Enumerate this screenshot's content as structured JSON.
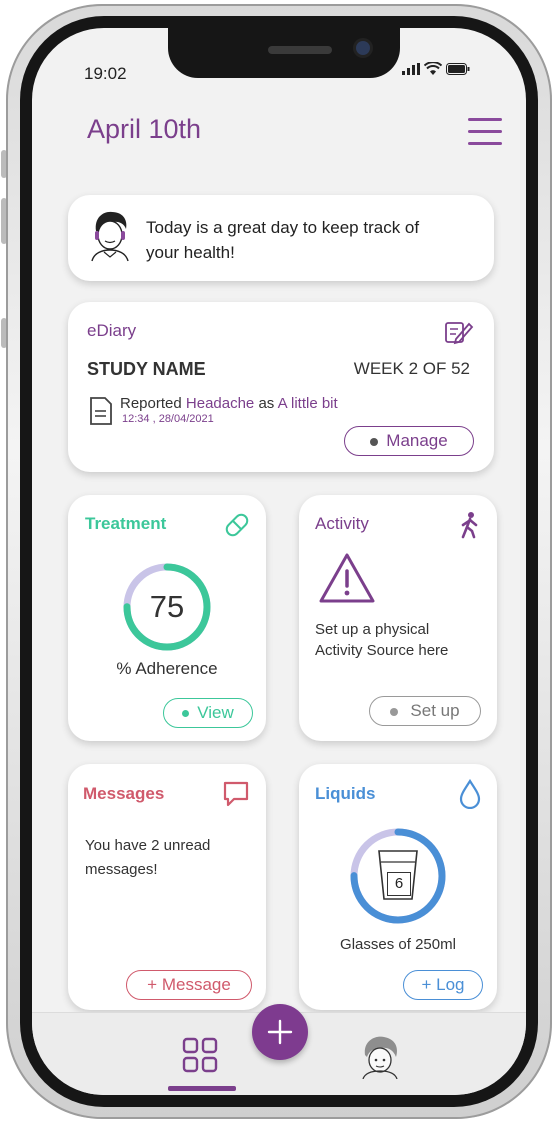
{
  "status": {
    "time": "19:02"
  },
  "header": {
    "title": "April 10th"
  },
  "greeting": {
    "text_line1": "Today is a great day to keep track of",
    "text_line2": "your health!"
  },
  "ediary": {
    "label": "eDiary",
    "study_name": "STUDY NAME",
    "week": "WEEK 2 OF 52",
    "report_prefix": "Reported",
    "report_symptom": "Headache",
    "report_mid": "as",
    "report_level": "A little bit",
    "report_time": "12:34 , 28/04/2021",
    "manage_label": "Manage"
  },
  "treatment": {
    "label": "Treatment",
    "value": "75",
    "value_fraction": 0.75,
    "caption": "% Adherence",
    "view_label": "View"
  },
  "activity": {
    "label": "Activity",
    "text_line1": "Set up a physical",
    "text_line2": "Activity Source here",
    "setup_label": "Set up"
  },
  "messages": {
    "label": "Messages",
    "text_line1": "You have 2 unread",
    "text_line2": "messages!",
    "button_label": "+ Message"
  },
  "liquids": {
    "label": "Liquids",
    "value": "6",
    "value_fraction": 0.75,
    "caption": "Glasses of 250ml",
    "button_label": "+ Log"
  },
  "colors": {
    "purple": "#7b3f8c",
    "green": "#3cc79a",
    "red": "#d05a6c",
    "blue": "#4a8fd6",
    "lavender": "#c9c4e8"
  },
  "icons": [
    "signal-icon",
    "wifi-icon",
    "battery-icon",
    "menu-icon",
    "avatar-icon",
    "notepad-icon",
    "document-icon",
    "pill-icon",
    "walking-icon",
    "warning-icon",
    "chat-icon",
    "drop-icon",
    "glass-icon",
    "grid-icon",
    "plus-icon",
    "profile-icon"
  ]
}
